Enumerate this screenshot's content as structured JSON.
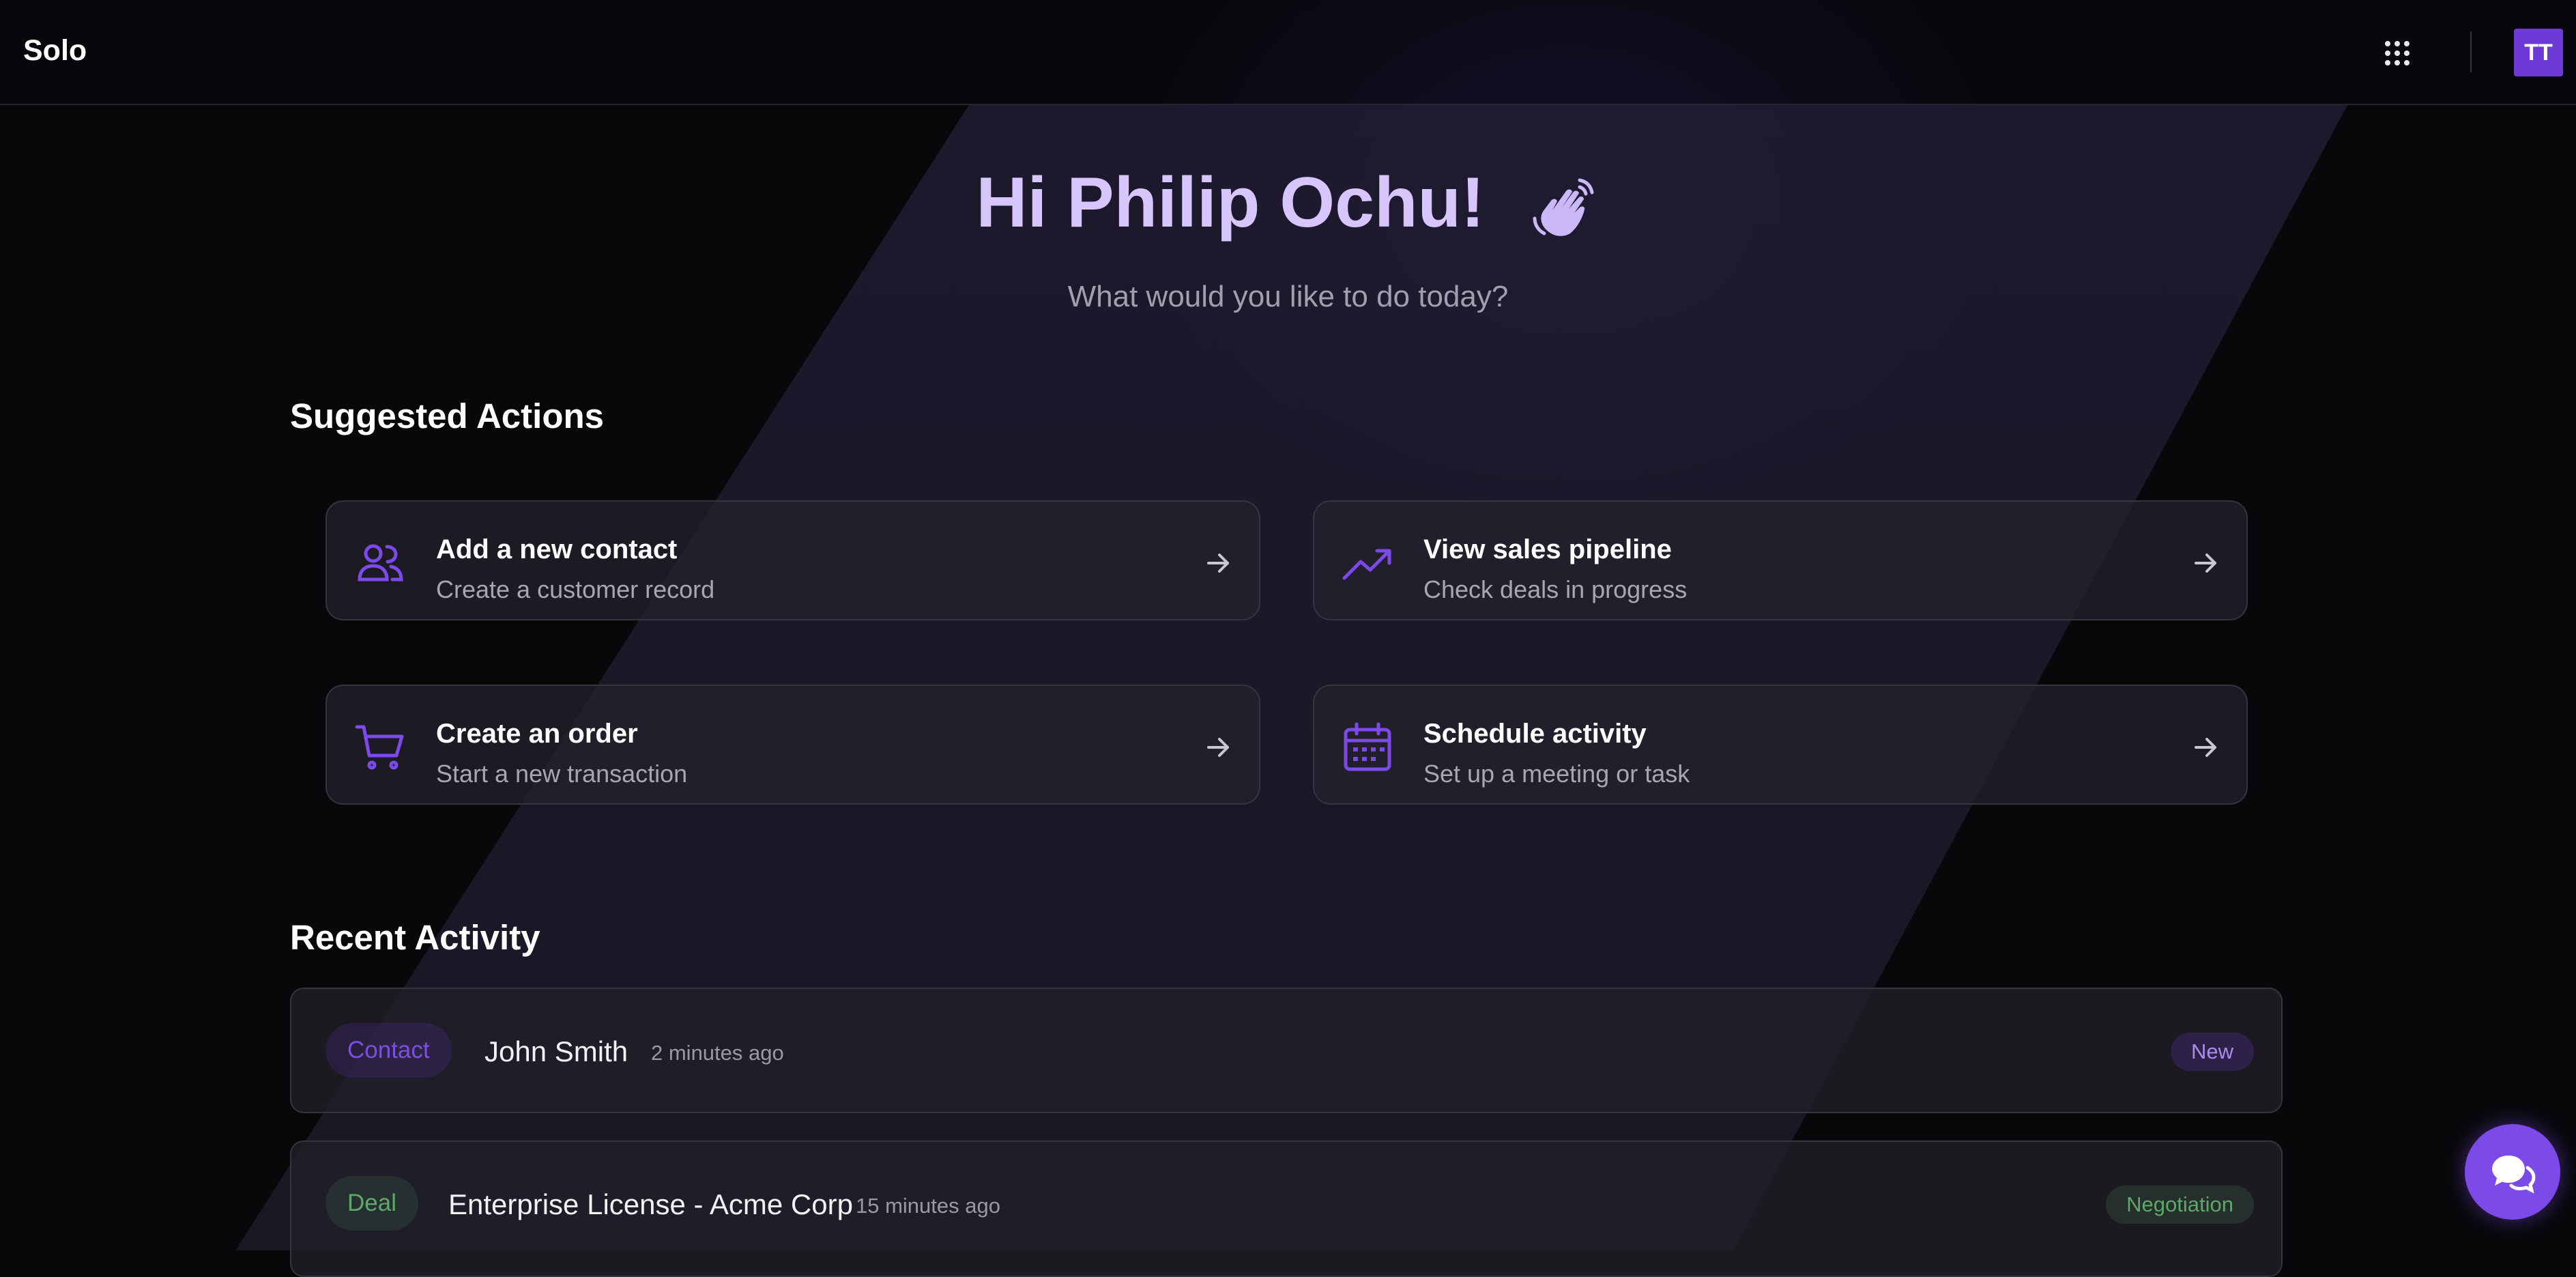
{
  "app": {
    "brand": "Solo",
    "avatar_initials": "TT",
    "accent_color": "#6d3ad8"
  },
  "header": {
    "greeting": "Hi Philip Ochu!",
    "subtitle": "What would you like to do today?"
  },
  "suggested": {
    "title": "Suggested Actions",
    "actions": [
      {
        "title": "Add a new contact",
        "description": "Create a customer record",
        "icon": "users-icon"
      },
      {
        "title": "View sales pipeline",
        "description": "Check deals in progress",
        "icon": "trending-up-icon"
      },
      {
        "title": "Create an order",
        "description": "Start a new transaction",
        "icon": "shopping-cart-icon"
      },
      {
        "title": "Schedule activity",
        "description": "Set up a meeting or task",
        "icon": "calendar-icon"
      }
    ]
  },
  "recent": {
    "title": "Recent Activity",
    "items": [
      {
        "type": "Contact",
        "name": "John Smith",
        "time": "2 minutes ago",
        "status": "New",
        "type_color": "#7d4fe0",
        "status_color": "#a98cf0"
      },
      {
        "type": "Deal",
        "name": "Enterprise License - Acme Corp",
        "time": "15 minutes ago",
        "status": "Negotiation",
        "type_color": "#5fa86a",
        "status_color": "#5fa86a"
      }
    ]
  },
  "icons": {
    "apps": "grid-dots-icon",
    "wave": "waving-hand-icon",
    "chat": "chat-bubble-icon",
    "arrow": "arrow-right-icon"
  }
}
